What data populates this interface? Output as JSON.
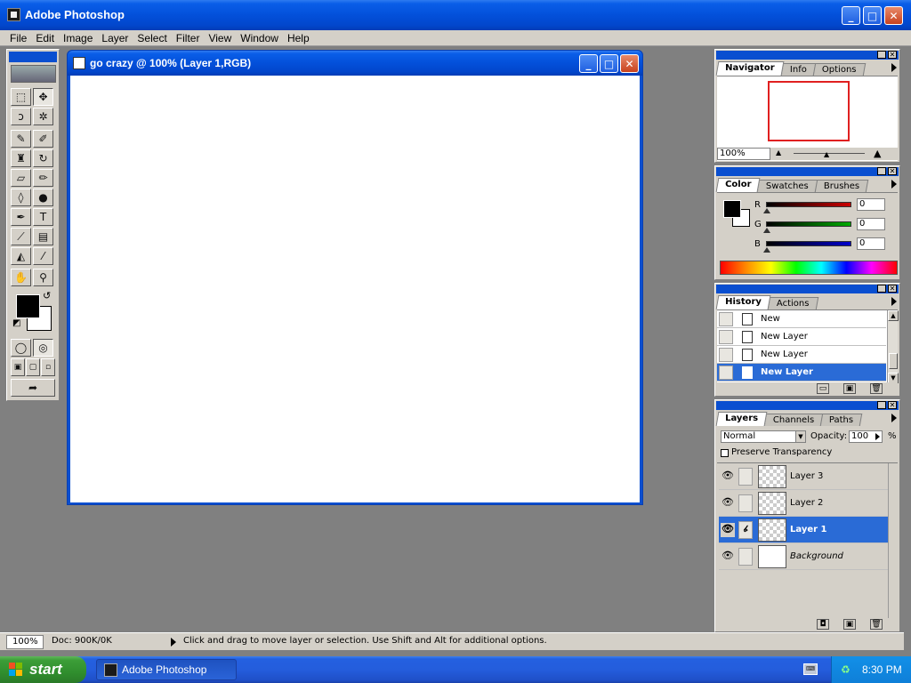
{
  "app": {
    "title": "Adobe Photoshop",
    "minimize": "_",
    "maximize": "□",
    "close": "✕"
  },
  "menu": [
    "File",
    "Edit",
    "Image",
    "Layer",
    "Select",
    "Filter",
    "View",
    "Window",
    "Help"
  ],
  "document": {
    "title": "go crazy @ 100% (Layer 1,RGB)"
  },
  "toolbox": {
    "tools": [
      {
        "name": "marquee-tool",
        "glyph": "⬚"
      },
      {
        "name": "move-tool",
        "glyph": "✥"
      },
      {
        "name": "lasso-tool",
        "glyph": "ↄ"
      },
      {
        "name": "magic-wand-tool",
        "glyph": "✲"
      },
      {
        "name": "airbrush-tool",
        "glyph": "✎"
      },
      {
        "name": "paintbrush-tool",
        "glyph": "✐"
      },
      {
        "name": "rubber-stamp-tool",
        "glyph": "♜"
      },
      {
        "name": "history-brush-tool",
        "glyph": "↻"
      },
      {
        "name": "eraser-tool",
        "glyph": "▱"
      },
      {
        "name": "pencil-tool",
        "glyph": "✏"
      },
      {
        "name": "blur-tool",
        "glyph": "◊"
      },
      {
        "name": "burn-tool",
        "glyph": "●"
      },
      {
        "name": "pen-tool",
        "glyph": "✒"
      },
      {
        "name": "type-tool",
        "glyph": "T"
      },
      {
        "name": "measure-tool",
        "glyph": "⟋"
      },
      {
        "name": "gradient-tool",
        "glyph": "▤"
      },
      {
        "name": "paint-bucket-tool",
        "glyph": "◭"
      },
      {
        "name": "eyedropper-tool",
        "glyph": "⁄"
      },
      {
        "name": "hand-tool",
        "glyph": "✋"
      },
      {
        "name": "zoom-tool",
        "glyph": "⚲"
      }
    ],
    "mode_standard": "◯",
    "mode_quickmask": "◎",
    "screen_modes": [
      "▣",
      "▢",
      "▫"
    ],
    "jump_to": "➦",
    "swap_colors": "↺",
    "default_colors": "◩"
  },
  "navigator": {
    "tabs": [
      "Navigator",
      "Info",
      "Options"
    ],
    "zoom": "100%",
    "zoom_out": "▲",
    "zoom_in": "▲"
  },
  "color": {
    "tabs": [
      "Color",
      "Swatches",
      "Brushes"
    ],
    "channels": [
      {
        "label": "R",
        "value": "0"
      },
      {
        "label": "G",
        "value": "0"
      },
      {
        "label": "B",
        "value": "0"
      }
    ],
    "colors": {
      "r": "#cc0000",
      "g": "#00aa00",
      "b": "#0000cc"
    }
  },
  "history": {
    "tabs": [
      "History",
      "Actions"
    ],
    "items": [
      "New",
      "New Layer",
      "New Layer",
      "New Layer"
    ],
    "selected_index": 3,
    "footer": [
      "▭",
      "▣",
      "🗑"
    ]
  },
  "layers": {
    "tabs": [
      "Layers",
      "Channels",
      "Paths"
    ],
    "blend_mode": "Normal",
    "opacity_label": "Opacity:",
    "opacity_value": "100",
    "opacity_unit": "%",
    "preserve_transparency": "Preserve Transparency",
    "eye": "👁",
    "brush": "𝒷",
    "items": [
      {
        "name": "Layer 3",
        "transparent": true
      },
      {
        "name": "Layer 2",
        "transparent": true
      },
      {
        "name": "Layer 1",
        "transparent": true,
        "selected": true
      },
      {
        "name": "Background",
        "transparent": false
      }
    ],
    "footer": [
      "◘",
      "▣",
      "🗑"
    ]
  },
  "status": {
    "zoom": "100%",
    "doc": "Doc: 900K/0K",
    "message": "Click and drag to move layer or selection.  Use Shift and Alt for additional options."
  },
  "taskbar": {
    "start": "start",
    "task": "Adobe Photoshop",
    "clock": "8:30 PM",
    "tray_icon": "♻",
    "keyboard_icon": "⌨"
  }
}
